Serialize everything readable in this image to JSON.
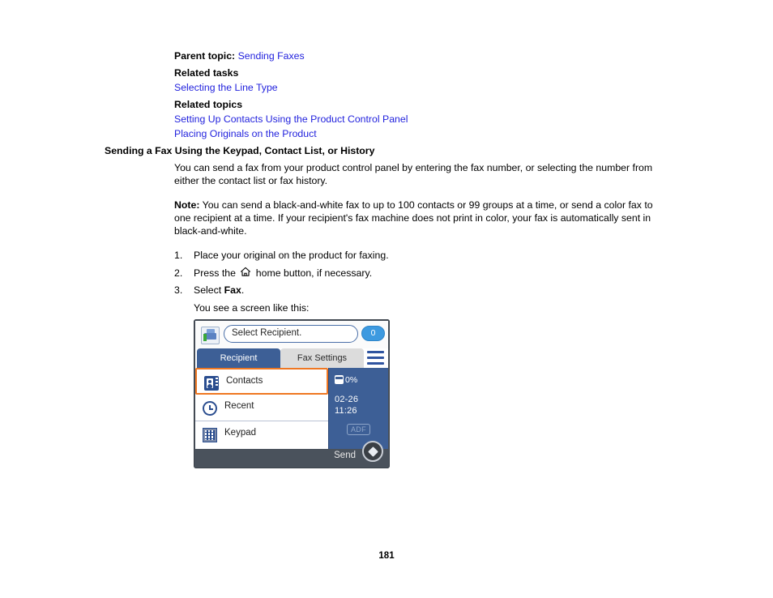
{
  "document": {
    "parent_topic_label": "Parent topic:",
    "parent_topic_link": "Sending Faxes",
    "related_tasks_heading": "Related tasks",
    "related_tasks_links": [
      "Selecting the Line Type"
    ],
    "related_topics_heading": "Related topics",
    "related_topics_links": [
      "Setting Up Contacts Using the Product Control Panel",
      "Placing Originals on the Product"
    ],
    "section_heading": "Sending a Fax Using the Keypad, Contact List, or History",
    "intro_paragraph": "You can send a fax from your product control panel by entering the fax number, or selecting the number from either the contact list or fax history.",
    "note_label": "Note:",
    "note_text": "You can send a black-and-white fax to up to 100 contacts or 99 groups at a time, or send a color fax to one recipient at a time. If your recipient's fax machine does not print in color, your fax is automatically sent in black-and-white.",
    "steps": [
      {
        "number": "1.",
        "text_before": "Place your original on the product for faxing.",
        "icon": "",
        "text_after": "",
        "bold": ""
      },
      {
        "number": "2.",
        "text_before": "Press the",
        "icon": "home-icon",
        "text_after": "home button, if necessary.",
        "bold": ""
      },
      {
        "number": "3.",
        "text_before": "Select",
        "icon": "",
        "bold": "Fax",
        "text_after": "."
      }
    ],
    "screen_caption": "You see a screen like this:",
    "page_number": "181",
    "link_color": "#2222dd"
  },
  "lcd": {
    "top_bar": {
      "fax_icon": "fax-machine-icon",
      "recipient_field_value": "Select Recipient.",
      "recipient_count_badge": "0"
    },
    "tabs": [
      {
        "label": "Recipient",
        "active": true
      },
      {
        "label": "Fax Settings",
        "active": false
      }
    ],
    "menu_icon": "hamburger-menu-icon",
    "menu_items": [
      {
        "label": "Contacts",
        "icon": "contacts-icon",
        "selected": true
      },
      {
        "label": "Recent",
        "icon": "recent-history-icon",
        "selected": false
      },
      {
        "label": "Keypad",
        "icon": "keypad-icon",
        "selected": false
      }
    ],
    "status_panel": {
      "memory_icon": "memory-icon",
      "memory_percent": "0%",
      "date": "02-26",
      "time": "11:26",
      "adf_badge": "ADF"
    },
    "bottom": {
      "send_label": "Send",
      "start_button_icon": "start-button-icon"
    },
    "colors": {
      "tab_active_bg": "#3d5f96",
      "tab_inactive_bg": "#dcdcdc",
      "selection_outline": "#ef7722",
      "status_panel_bg": "#3d5f96",
      "badge_bg": "#3d9ae0",
      "bezel": "#4a525c"
    }
  }
}
